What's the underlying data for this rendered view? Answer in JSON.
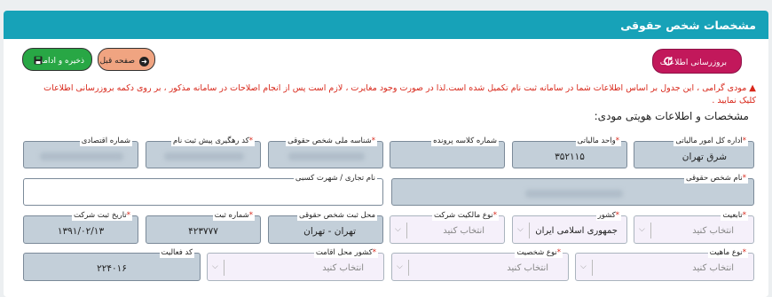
{
  "header": {
    "title": "مشخصات شخص حقوقی"
  },
  "buttons": {
    "save": "ذخیره و ادامه",
    "prev": "صفحه قبل",
    "sync": "بروزرسانی اطلاعات"
  },
  "warning": "مودی گرامی ، این جدول بر اساس اطلاعات شما در سامانه ثبت نام تکمیل شده است.لذا در صورت وجود مغایرت ، لازم است پس از انجام اصلاحات در سامانه مذکور ، بر روی دکمه بروزرسانی اطلاعات کلیک نمایید .",
  "section_title": "مشخصات و اطلاعات هویتی مودی:",
  "fields": {
    "general_dept": {
      "label": "اداره کل امور مالیاتی",
      "required": "*",
      "value": "شرق تهران"
    },
    "tax_unit": {
      "label": "واحد مالیاتی",
      "required": "*",
      "value": "۳۵۲۱۱۵"
    },
    "file_class": {
      "label": "شماره کلاسه پرونده"
    },
    "national_id": {
      "label": "شناسه ملی شخص حقوقی",
      "required": "*"
    },
    "tracking_code": {
      "label": "کد رهگیری پیش ثبت نام",
      "required": "*"
    },
    "economic_no": {
      "label": "شماره اقتصادی"
    },
    "company_name": {
      "label": "نام شخص حقوقی",
      "required": "*"
    },
    "trade_name": {
      "label": "نام تجاری / شهرت کسبی",
      "value": ""
    },
    "nationality": {
      "label": "تابعیت",
      "required": "*",
      "placeholder": "انتخاب کنید"
    },
    "country": {
      "label": "کشور",
      "required": "*",
      "value": "جمهوری اسلامی ایران"
    },
    "ownership_type": {
      "label": "نوع مالکیت شرکت",
      "required": "*",
      "placeholder": "انتخاب کنید"
    },
    "reg_place": {
      "label": "محل ثبت شخص حقوقی",
      "value": "تهران - تهران"
    },
    "reg_number": {
      "label": "شماره ثبت",
      "required": "*",
      "value": "۴۲۳۷۷۷"
    },
    "reg_date": {
      "label": "تاریخ ثبت شرکت",
      "required": "*",
      "value": "۱۳۹۱/۰۲/۱۳"
    },
    "entity_type": {
      "label": "نوع ماهیت",
      "required": "*",
      "placeholder": "انتخاب کنید"
    },
    "person_type": {
      "label": "نوع شخصیت",
      "required": "*",
      "placeholder": "انتخاب کنید"
    },
    "residence_country": {
      "label": "کشور محل اقامت",
      "required": "*",
      "placeholder": "انتخاب کنید"
    },
    "activity_code": {
      "label": "کد فعالیت",
      "value": "۲۲۴۰۱۶"
    }
  }
}
